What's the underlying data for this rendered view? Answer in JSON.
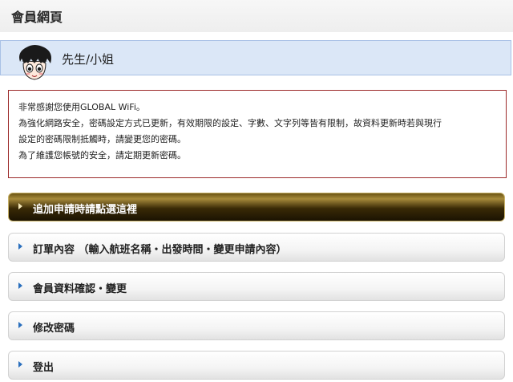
{
  "header": {
    "title": "會員網頁"
  },
  "user": {
    "name": "先生/小姐",
    "avatar_icon": "anime-boy-avatar"
  },
  "notice": {
    "lines": [
      "非常感謝您使用GLOBAL WiFi。",
      "為強化網路安全，密碼設定方式已更新，有效期限的設定、字數、文字列等皆有限制，故資料更新時若與現行",
      "設定的密碼限制抵觸時，請變更您的密碼。",
      "為了維護您帳號的安全，請定期更新密碼。"
    ]
  },
  "menu": {
    "items": [
      {
        "label": "追加申請時請點選這裡",
        "active": true
      },
      {
        "label": "訂單內容 （輸入航班名稱・出發時間・變更申請內容）",
        "active": false
      },
      {
        "label": "會員資料確認・變更",
        "active": false
      },
      {
        "label": "修改密碼",
        "active": false
      },
      {
        "label": "登出",
        "active": false
      }
    ]
  },
  "colors": {
    "accent": "#2a6fbd",
    "notice_border": "#9c2a2a",
    "userbar_bg": "#dbe7f7"
  }
}
